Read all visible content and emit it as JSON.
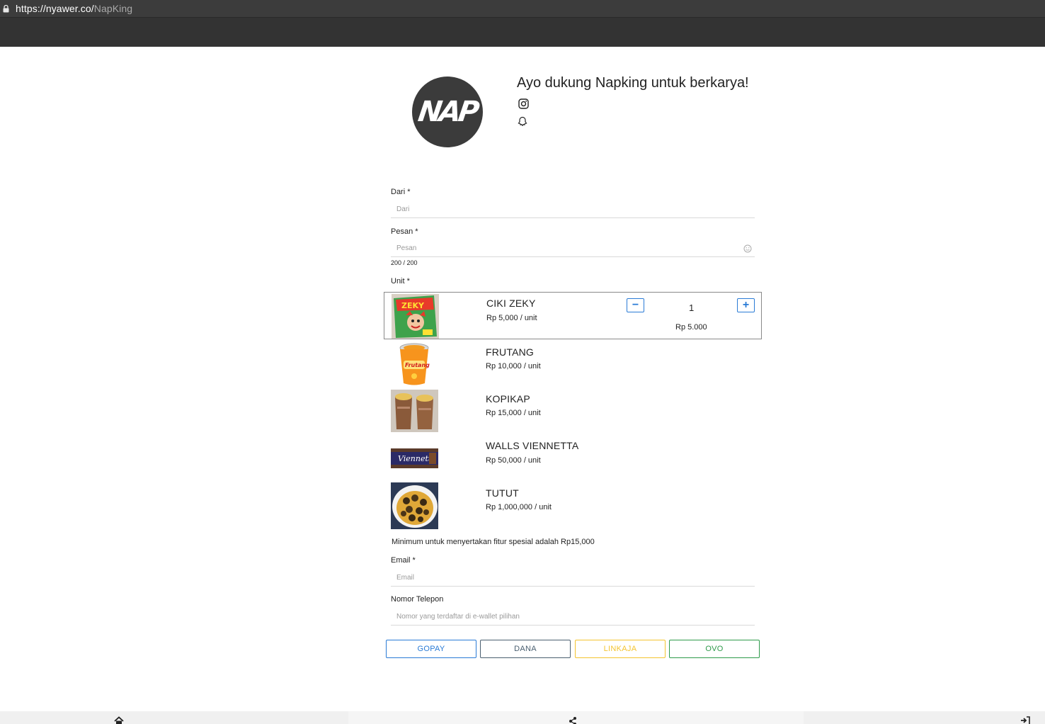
{
  "browser": {
    "url_host": "https://nyawer.co/",
    "url_path": "NapKing"
  },
  "profile": {
    "avatar_text": "NAP",
    "headline": "Ayo dukung Napking untuk berkarya!",
    "social_icons": [
      "instagram-icon",
      "ghost-icon"
    ]
  },
  "form": {
    "from_label": "Dari *",
    "from_placeholder": "Dari",
    "message_label": "Pesan *",
    "message_placeholder": "Pesan",
    "message_counter": "200 / 200",
    "unit_label": "Unit *",
    "units": [
      {
        "name": "CIKI ZEKY",
        "price": "Rp 5,000 / unit",
        "selected": true,
        "qty": "1",
        "total": "Rp 5.000",
        "image": "snack-bag"
      },
      {
        "name": "FRUTANG",
        "price": "Rp 10,000 / unit",
        "selected": false,
        "image": "drink-cup"
      },
      {
        "name": "KOPIKAP",
        "price": "Rp 15,000 / unit",
        "selected": false,
        "image": "coffee-cups"
      },
      {
        "name": "WALLS VIENNETTA",
        "price": "Rp 50,000 / unit",
        "selected": false,
        "image": "ice-cream-box"
      },
      {
        "name": "TUTUT",
        "price": "Rp 1,000,000 / unit",
        "selected": false,
        "image": "snail-dish"
      }
    ],
    "qty_minus": "−",
    "qty_plus": "+",
    "special_note": "Minimum untuk menyertakan fitur spesial adalah Rp15,000",
    "email_label": "Email *",
    "email_placeholder": "Email",
    "phone_label": "Nomor Telepon",
    "phone_placeholder": "Nomor yang terdaftar di e-wallet pilihan"
  },
  "payment": {
    "gopay": "GOPAY",
    "dana": "DANA",
    "linkaja": "LINKAJA",
    "ovo": "OVO",
    "colors": {
      "gopay": "#2a7bd6",
      "dana": "#4a5f70",
      "linkaja": "#f4c430",
      "ovo": "#2e9a4a"
    }
  },
  "bottom_nav": [
    "home-icon",
    "share-icon",
    "login-icon"
  ]
}
